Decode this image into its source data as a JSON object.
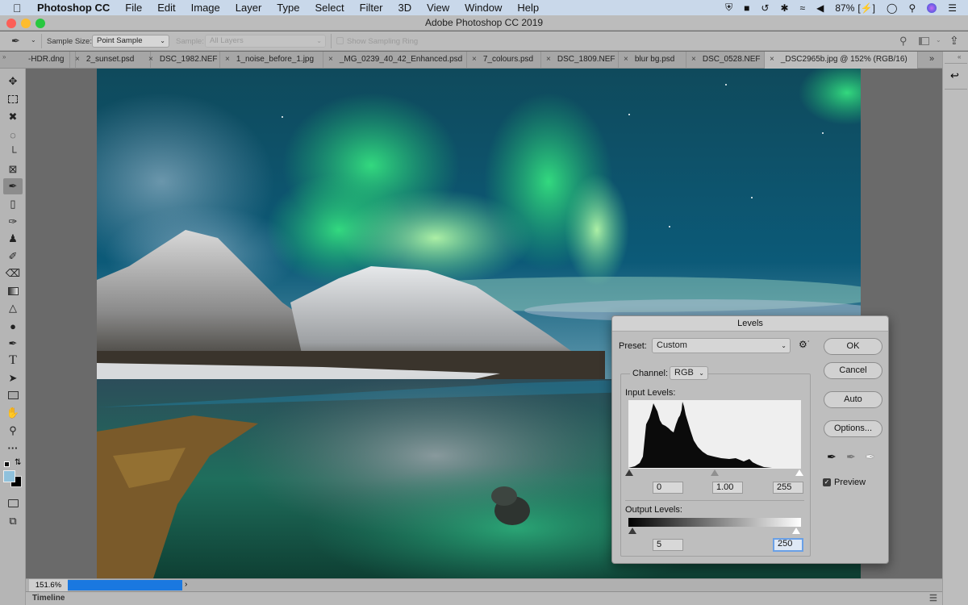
{
  "menubar": {
    "app_name": "Photoshop CC",
    "items": [
      "File",
      "Edit",
      "Image",
      "Layer",
      "Type",
      "Select",
      "Filter",
      "3D",
      "View",
      "Window",
      "Help"
    ],
    "battery": "87%"
  },
  "window": {
    "title": "Adobe Photoshop CC 2019"
  },
  "options_bar": {
    "sample_size_label": "Sample Size:",
    "sample_size_value": "Point Sample",
    "sample_label": "Sample:",
    "sample_value": "All Layers",
    "show_ring_label": "Show Sampling Ring"
  },
  "tabs": [
    {
      "label": "-HDR.dng",
      "active": false
    },
    {
      "label": "2_sunset.psd",
      "active": false
    },
    {
      "label": "DSC_1982.NEF",
      "active": false
    },
    {
      "label": "1_noise_before_1.jpg",
      "active": false
    },
    {
      "label": "_MG_0239_40_42_Enhanced.psd",
      "active": false
    },
    {
      "label": "7_colours.psd",
      "active": false
    },
    {
      "label": "DSC_1809.NEF",
      "active": false
    },
    {
      "label": "blur bg.psd",
      "active": false
    },
    {
      "label": "DSC_0528.NEF",
      "active": false
    },
    {
      "label": "_DSC2965b.jpg @ 152% (RGB/16)",
      "active": true
    }
  ],
  "tools": [
    "move",
    "marquee",
    "lasso",
    "quick-select",
    "crop",
    "frame",
    "eyedropper",
    "healing",
    "brush",
    "stamp",
    "history-brush",
    "eraser",
    "gradient",
    "blur",
    "dodge",
    "pen",
    "type",
    "path-select",
    "rectangle",
    "hand",
    "zoom",
    "more"
  ],
  "colors": {
    "foreground": "#8fc1dc",
    "background": "#000000"
  },
  "status": {
    "zoom": "151.6%"
  },
  "timeline": {
    "label": "Timeline"
  },
  "levels": {
    "title": "Levels",
    "preset_label": "Preset:",
    "preset_value": "Custom",
    "channel_label": "Channel:",
    "channel_value": "RGB",
    "input_label": "Input Levels:",
    "input_black": "0",
    "input_gamma": "1.00",
    "input_white": "255",
    "output_label": "Output Levels:",
    "output_black": "5",
    "output_white": "250",
    "buttons": {
      "ok": "OK",
      "cancel": "Cancel",
      "auto": "Auto",
      "options": "Options..."
    },
    "preview_label": "Preview",
    "preview_checked": true
  }
}
